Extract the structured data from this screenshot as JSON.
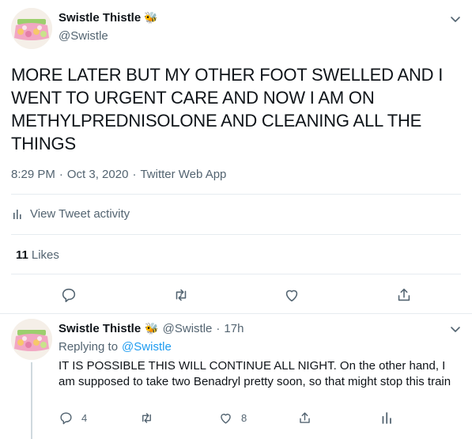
{
  "main_tweet": {
    "display_name": "Swistle Thistle",
    "emoji": "🐝",
    "handle": "@Swistle",
    "text": "MORE LATER BUT MY OTHER FOOT SWELLED AND I WENT TO URGENT CARE AND NOW I AM ON METHYLPREDNISOLONE AND CLEANING ALL THE THINGS",
    "time": "8:29 PM",
    "date": "Oct 3, 2020",
    "source": "Twitter Web App",
    "separator": "·",
    "activity_label": "View Tweet activity",
    "likes_count": "11",
    "likes_label": "Likes"
  },
  "reply_tweet": {
    "display_name": "Swistle Thistle",
    "emoji": "🐝",
    "handle": "@Swistle",
    "separator": "·",
    "age": "17h",
    "replying_prefix": "Replying to",
    "replying_to": "@Swistle",
    "text": "IT IS POSSIBLE THIS WILL CONTINUE ALL NIGHT. On the other hand, I am supposed to take two Benadryl pretty soon, so that might stop this train",
    "reply_count": "4",
    "like_count": "8"
  },
  "colors": {
    "accent": "#1d9bf0",
    "muted": "#536471",
    "divider": "#e6ecf0"
  }
}
